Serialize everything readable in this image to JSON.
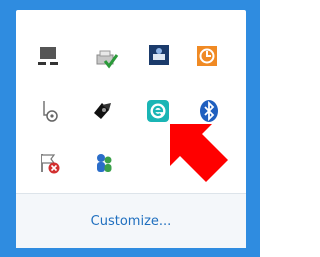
{
  "tray_icons": [
    {
      "name": "monitor-icon"
    },
    {
      "name": "printer-check-icon"
    },
    {
      "name": "app-shortcut-icon"
    },
    {
      "name": "clock-orange-icon"
    },
    {
      "name": "disk-gear-icon"
    },
    {
      "name": "speaker-icon"
    },
    {
      "name": "eset-icon"
    },
    {
      "name": "bluetooth-icon"
    },
    {
      "name": "flag-error-icon"
    },
    {
      "name": "people-icon"
    }
  ],
  "customize_link": "Customize...",
  "annotation": {
    "pointer": "red-arrow-icon"
  },
  "colors": {
    "frame": "#2f8ce0",
    "link": "#1f6fbf",
    "arrow": "#ff0000",
    "eset": "#1ab5b5",
    "bluetooth": "#1f5fbf",
    "orange": "#f08a24"
  }
}
